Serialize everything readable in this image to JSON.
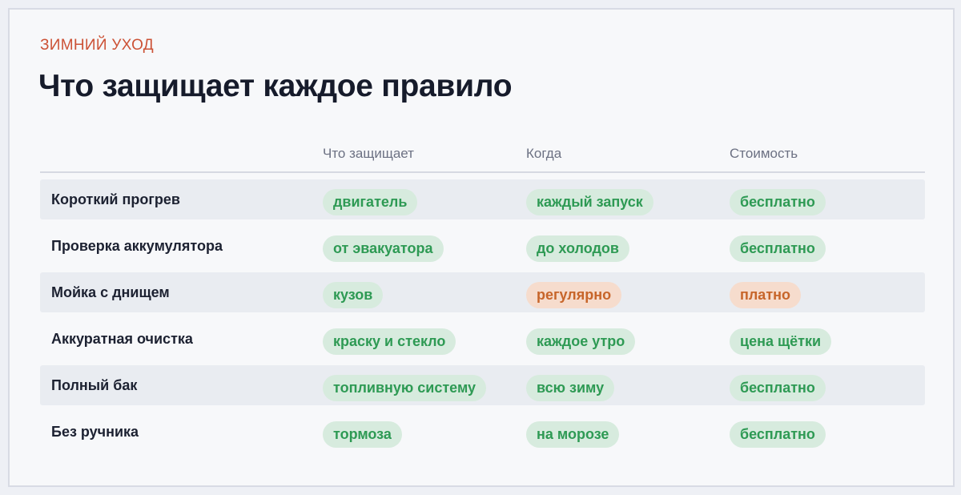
{
  "eyebrow": "ЗИМНИЙ УХОД",
  "title": "Что защищает каждое правило",
  "columns": [
    "Что защищает",
    "Когда",
    "Стоимость"
  ],
  "colors": {
    "accent": "#cc5236",
    "good_bg": "#d7ebde",
    "good_text": "#2e9a54",
    "warn_bg": "#f6dccd",
    "warn_text": "#c7652a"
  },
  "rows": [
    {
      "label": "Короткий прогрев",
      "protects": {
        "text": "двигатель",
        "tone": "good"
      },
      "when": {
        "text": "каждый запуск",
        "tone": "good"
      },
      "cost": {
        "text": "бесплатно",
        "tone": "good"
      }
    },
    {
      "label": "Проверка аккумулятора",
      "protects": {
        "text": "от эвакуатора",
        "tone": "good"
      },
      "when": {
        "text": "до холодов",
        "tone": "good"
      },
      "cost": {
        "text": "бесплатно",
        "tone": "good"
      }
    },
    {
      "label": "Мойка с днищем",
      "protects": {
        "text": "кузов",
        "tone": "good"
      },
      "when": {
        "text": "регулярно",
        "tone": "warn"
      },
      "cost": {
        "text": "платно",
        "tone": "warn"
      }
    },
    {
      "label": "Аккуратная очистка",
      "protects": {
        "text": "краску и стекло",
        "tone": "good"
      },
      "when": {
        "text": "каждое утро",
        "tone": "good"
      },
      "cost": {
        "text": "цена щётки",
        "tone": "good"
      }
    },
    {
      "label": "Полный бак",
      "protects": {
        "text": "топливную систему",
        "tone": "good"
      },
      "when": {
        "text": "всю зиму",
        "tone": "good"
      },
      "cost": {
        "text": "бесплатно",
        "tone": "good"
      }
    },
    {
      "label": "Без ручника",
      "protects": {
        "text": "тормоза",
        "tone": "good"
      },
      "when": {
        "text": "на морозе",
        "tone": "good"
      },
      "cost": {
        "text": "бесплатно",
        "tone": "good"
      }
    }
  ]
}
